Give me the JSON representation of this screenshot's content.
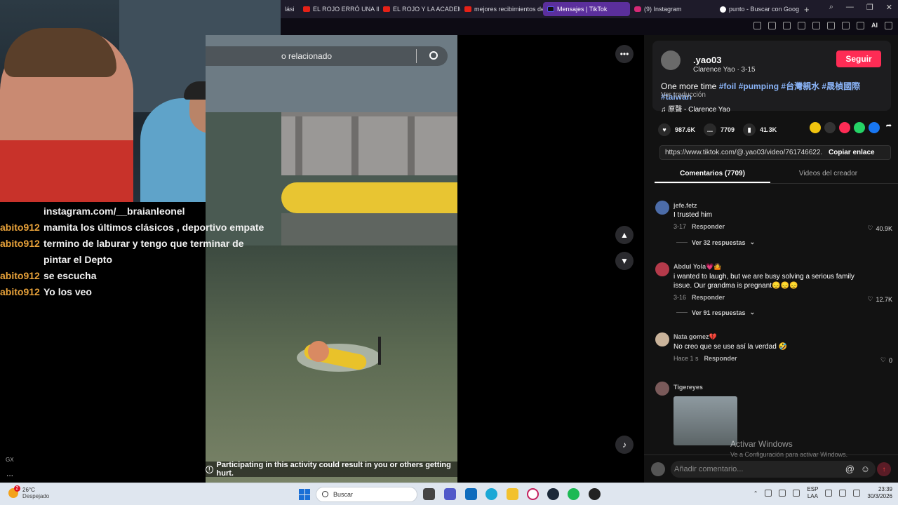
{
  "browser": {
    "tabs": [
      {
        "title": "lási",
        "favicon": "generic-icon",
        "active": false
      },
      {
        "title": "EL ROJO ERRÓ UNA INC",
        "favicon": "youtube-icon",
        "active": false
      },
      {
        "title": "EL ROJO Y LA ACADEMI",
        "favicon": "youtube-icon",
        "active": false
      },
      {
        "title": "mejores recibimientos de",
        "favicon": "youtube-icon",
        "active": false
      },
      {
        "title": "Mensajes | TikTok",
        "favicon": "tiktok-icon",
        "active": true
      },
      {
        "title": "(9) Instagram",
        "favicon": "instagram-icon",
        "active": false
      },
      {
        "title": "punto - Buscar con Goog",
        "favicon": "google-icon",
        "active": false
      }
    ],
    "new_tab": "+",
    "ai_label": "AI"
  },
  "chat": {
    "messages": [
      {
        "user": "",
        "text": "instagram.com/__braianleonel"
      },
      {
        "user": "abito912",
        "text": "mamita los últimos clásicos , deportivo empate"
      },
      {
        "user": "abito912",
        "text": "termino de laburar y tengo que terminar de pintar el Depto"
      },
      {
        "user": "abito912",
        "text": "se escucha"
      },
      {
        "user": "abito912",
        "text": "Yo los veo"
      }
    ]
  },
  "sidebar": {
    "gx_label": "GX",
    "more": "..."
  },
  "video": {
    "search_text": "o relacionado",
    "warning": "Participating in this activity could result in you or others getting hurt.",
    "more_icon": "more-icon",
    "prev_icon": "chevron-up-icon",
    "next_icon": "chevron-down-icon",
    "volume_icon": "volume-icon"
  },
  "post": {
    "username": ".yao03",
    "subtitle": "Clarence Yao · 3-15",
    "follow_label": "Seguir",
    "caption_text": "One more time",
    "hashtags": [
      "#foil",
      "#pumping",
      "#台灣親水",
      "#晟楨國際",
      "#taiwan"
    ],
    "translate_label": "Ver traducción",
    "music": "原聲 - Clarence Yao",
    "likes": "987.6K",
    "comments": "7709",
    "saves": "41.3K",
    "link": "https://www.tiktok.com/@.yao03/video/761746622...",
    "copy_label": "Copiar enlace"
  },
  "tabs": {
    "comments": "Comentarios (7709)",
    "creator_videos": "Videos del creador"
  },
  "comments": [
    {
      "user": "jefe.fetz",
      "text": "I trusted him",
      "date": "3-17",
      "reply": "Responder",
      "likes": "40.9K",
      "more": "Ver 32 respuestas"
    },
    {
      "user": "Abdul Yola💗🤷",
      "text": "i wanted to laugh, but we are busy solving a serious family issue. Our grandma is pregnant😞😞😞",
      "date": "3-16",
      "reply": "Responder",
      "likes": "12.7K",
      "more": "Ver 91 respuestas"
    },
    {
      "user": "Nata gomez💔",
      "text": "No creo que se use así la verdad 🤣",
      "date": "Hace 1 s",
      "reply": "Responder",
      "likes": "0"
    },
    {
      "user": "Tigereyes",
      "text": ""
    }
  ],
  "add_comment": {
    "placeholder": "Añadir comentario...",
    "at_icon": "@"
  },
  "windows_activation": {
    "title": "Activar Windows",
    "subtitle": "Ve a Configuración para activar Windows."
  },
  "taskbar": {
    "weather_temp": "26°C",
    "weather_desc": "Despejado",
    "notification_count": "2",
    "search_label": "Buscar",
    "lang_top": "ESP",
    "lang_bottom": "LAA",
    "time": "23:39",
    "date": "30/3/2026"
  },
  "colors": {
    "accent": "#fe2c55",
    "hashtag": "#8ab4f8",
    "chat_user": "#e8a23a",
    "active_tab": "#5b2f9c"
  }
}
